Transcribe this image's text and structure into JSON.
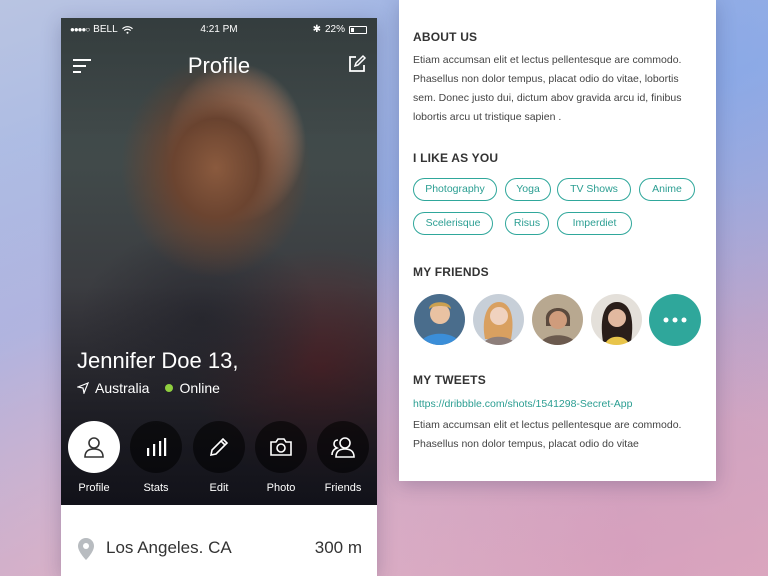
{
  "status_bar": {
    "carrier": "BELL",
    "time": "4:21 PM",
    "battery": "22%"
  },
  "nav": {
    "title": "Profile",
    "menu_icon": "hamburger-menu-icon",
    "edit_icon": "compose-icon"
  },
  "profile": {
    "name": "Jennifer Doe 13,",
    "country": "Australia",
    "status": "Online",
    "status_color": "#8fcf3f"
  },
  "tabs": [
    {
      "label": "Profile",
      "icon": "user-icon",
      "active": true
    },
    {
      "label": "Stats",
      "icon": "bar-chart-icon",
      "active": false
    },
    {
      "label": "Edit",
      "icon": "pencil-icon",
      "active": false
    },
    {
      "label": "Photo",
      "icon": "camera-icon",
      "active": false
    },
    {
      "label": "Friends",
      "icon": "friends-icon",
      "active": false
    }
  ],
  "location": {
    "city": "Los Angeles. CA",
    "distance": "300 m"
  },
  "details": {
    "about_title": "ABOUT US",
    "about_lines": [
      "Etiam accumsan elit et lectus pellentesque are commodo.",
      "Phasellus non dolor tempus, placat odio do vitae, lobortis",
      "sem. Donec justo dui, dictum abov gravida arcu id, finibus",
      "lobortis arcu ut tristique sapien ."
    ],
    "likes_title": "I LIKE AS YOU",
    "tags": [
      "Photography",
      "Yoga",
      "TV Shows",
      "Anime",
      "Scelerisque",
      "Risus",
      "Imperdiet"
    ],
    "friends_title": "MY FRIENDS",
    "tweets_title": "MY TWEETS",
    "tweet_link": "https://dribbble.com/shots/1541298-Secret-App",
    "tweet_lines": [
      "Etiam accumsan elit et lectus pellentesque are commodo.",
      "Phasellus non dolor tempus, placat odio do vitae"
    ]
  },
  "colors": {
    "accent": "#2fa79b",
    "online": "#8fcf3f",
    "text_dark": "#333333"
  }
}
